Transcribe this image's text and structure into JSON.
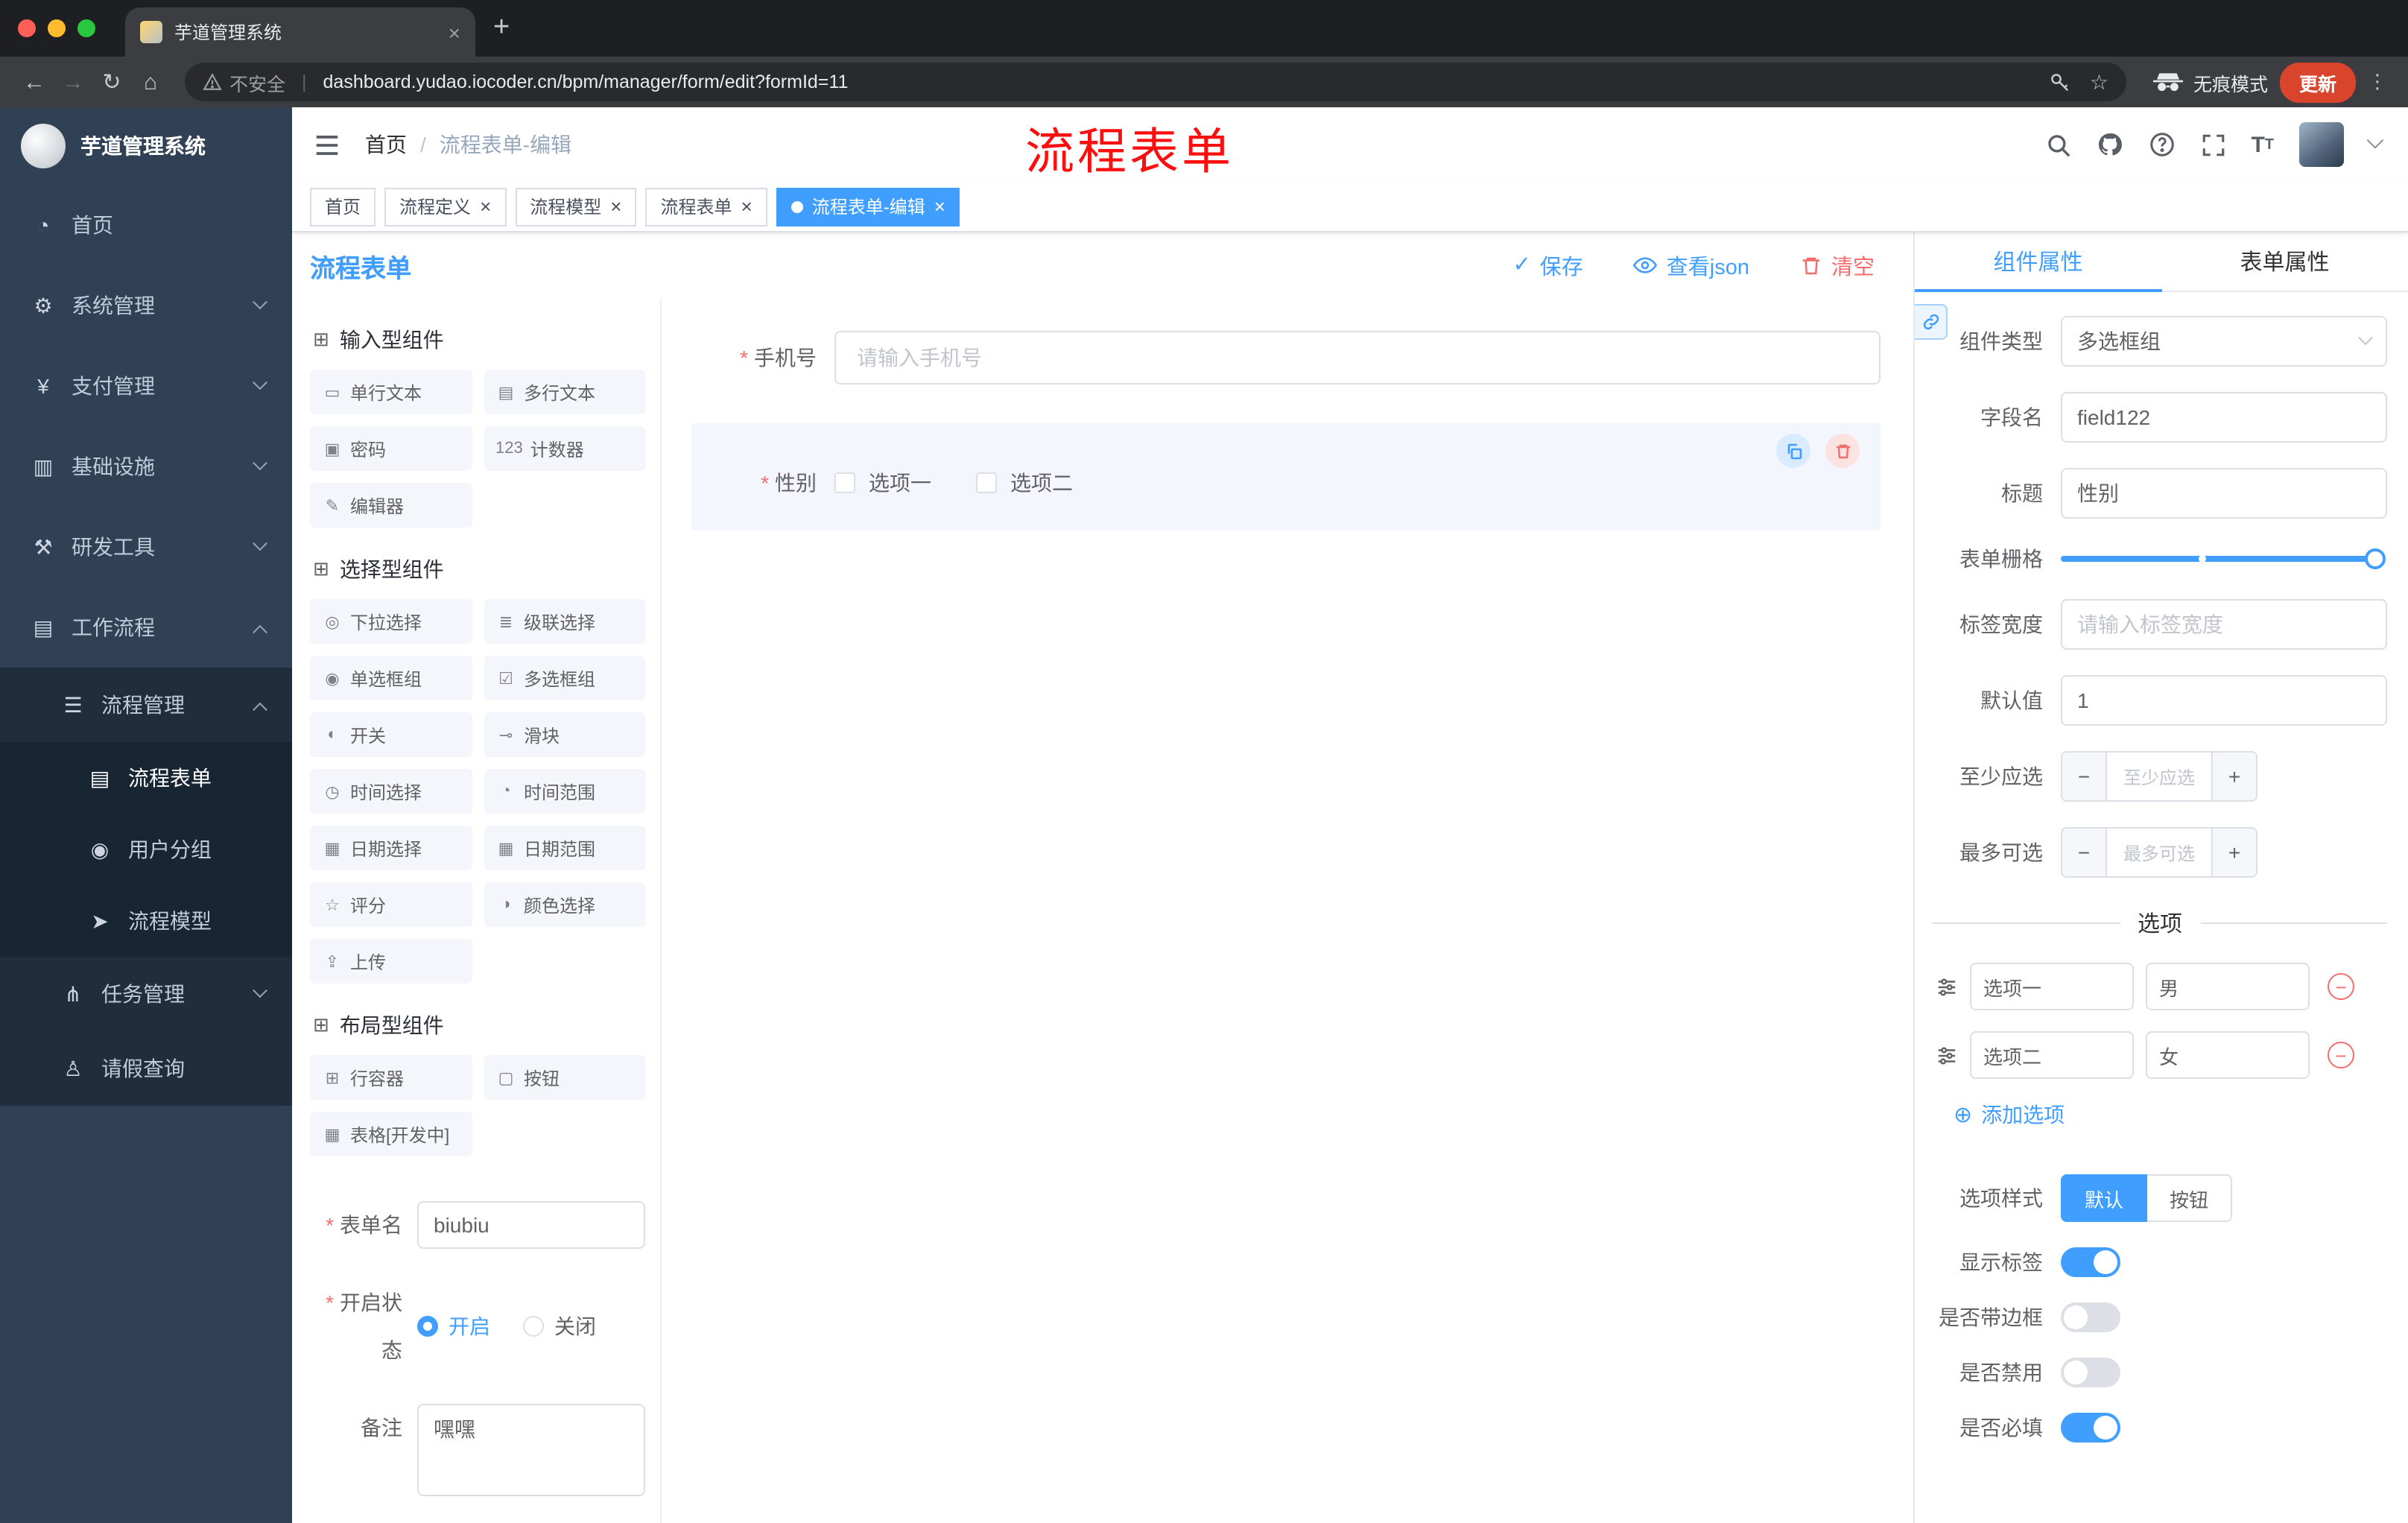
{
  "browser": {
    "tab_title": "芋道管理系统",
    "security_label": "不安全",
    "url": "dashboard.yudao.iocoder.cn/bpm/manager/form/edit?formId=11",
    "incognito_label": "无痕模式",
    "update_label": "更新"
  },
  "sidebar": {
    "logo_title": "芋道管理系统",
    "menu": [
      {
        "label": "首页",
        "icon": "dashboard-icon",
        "level": 0
      },
      {
        "label": "系统管理",
        "icon": "gear-icon",
        "level": 0,
        "chevron": "down"
      },
      {
        "label": "支付管理",
        "icon": "payment-icon",
        "level": 0,
        "chevron": "down"
      },
      {
        "label": "基础设施",
        "icon": "infrastructure-icon",
        "level": 0,
        "chevron": "down"
      },
      {
        "label": "研发工具",
        "icon": "tools-icon",
        "level": 0,
        "chevron": "down"
      },
      {
        "label": "工作流程",
        "icon": "workflow-icon",
        "level": 0,
        "chevron": "up"
      },
      {
        "label": "流程管理",
        "icon": "process-manage-icon",
        "level": 1,
        "chevron": "up"
      },
      {
        "label": "流程表单",
        "icon": "form-icon",
        "level": 2,
        "active": true
      },
      {
        "label": "用户分组",
        "icon": "user-group-icon",
        "level": 2
      },
      {
        "label": "流程模型",
        "icon": "process-model-icon",
        "level": 2
      },
      {
        "label": "任务管理",
        "icon": "task-icon",
        "level": 1,
        "chevron": "down"
      },
      {
        "label": "请假查询",
        "icon": "leave-query-icon",
        "level": 1
      }
    ]
  },
  "header": {
    "breadcrumb_home": "首页",
    "breadcrumb_current": "流程表单-编辑",
    "annotation": "流程表单"
  },
  "tags": [
    {
      "label": "首页"
    },
    {
      "label": "流程定义",
      "closable": true
    },
    {
      "label": "流程模型",
      "closable": true
    },
    {
      "label": "流程表单",
      "closable": true
    },
    {
      "label": "流程表单-编辑",
      "closable": true,
      "active": true
    }
  ],
  "designer": {
    "title": "流程表单",
    "save_label": "保存",
    "view_json_label": "查看json",
    "clear_label": "清空",
    "palette_sections": [
      {
        "title": "输入型组件",
        "items": [
          {
            "label": "单行文本",
            "icon": "text-field-icon"
          },
          {
            "label": "多行文本",
            "icon": "textarea-icon"
          },
          {
            "label": "密码",
            "icon": "password-icon"
          },
          {
            "label": "计数器",
            "icon": "counter-icon"
          },
          {
            "label": "编辑器",
            "icon": "editor-icon"
          }
        ]
      },
      {
        "title": "选择型组件",
        "items": [
          {
            "label": "下拉选择",
            "icon": "select-icon"
          },
          {
            "label": "级联选择",
            "icon": "cascader-icon"
          },
          {
            "label": "单选框组",
            "icon": "radio-group-icon"
          },
          {
            "label": "多选框组",
            "icon": "checkbox-group-icon"
          },
          {
            "label": "开关",
            "icon": "switch-icon"
          },
          {
            "label": "滑块",
            "icon": "slider-icon"
          },
          {
            "label": "时间选择",
            "icon": "time-icon"
          },
          {
            "label": "时间范围",
            "icon": "time-range-icon"
          },
          {
            "label": "日期选择",
            "icon": "date-icon"
          },
          {
            "label": "日期范围",
            "icon": "date-range-icon"
          },
          {
            "label": "评分",
            "icon": "rate-icon"
          },
          {
            "label": "颜色选择",
            "icon": "color-icon"
          },
          {
            "label": "上传",
            "icon": "upload-icon"
          }
        ]
      },
      {
        "title": "布局型组件",
        "items": [
          {
            "label": "行容器",
            "icon": "row-container-icon"
          },
          {
            "label": "按钮",
            "icon": "button-icon"
          },
          {
            "label": "表格[开发中]",
            "icon": "table-icon"
          }
        ]
      }
    ],
    "meta": {
      "form_name_label": "表单名",
      "form_name_value": "biubiu",
      "status_label": "开启状态",
      "status_on": "开启",
      "status_off": "关闭",
      "remark_label": "备注",
      "remark_value": "嘿嘿"
    },
    "canvas": {
      "phone_label": "手机号",
      "phone_placeholder": "请输入手机号",
      "gender_label": "性别",
      "gender_options": [
        "选项一",
        "选项二"
      ]
    }
  },
  "panel": {
    "tab_component": "组件属性",
    "tab_form": "表单属性",
    "component_type_label": "组件类型",
    "component_type_value": "多选框组",
    "field_name_label": "字段名",
    "field_name_value": "field122",
    "title_label": "标题",
    "title_value": "性别",
    "grid_label": "表单栅格",
    "label_width_label": "标签宽度",
    "label_width_placeholder": "请输入标签宽度",
    "default_label": "默认值",
    "default_value": "1",
    "min_label": "至少应选",
    "min_placeholder": "至少应选",
    "max_label": "最多可选",
    "max_placeholder": "最多可选",
    "options_title": "选项",
    "options": [
      {
        "label": "选项一",
        "value": "男"
      },
      {
        "label": "选项二",
        "value": "女"
      }
    ],
    "add_option_label": "添加选项",
    "option_style_label": "选项样式",
    "option_style_default": "默认",
    "option_style_button": "按钮",
    "switches": [
      {
        "label": "显示标签",
        "on": true
      },
      {
        "label": "是否带边框",
        "on": false
      },
      {
        "label": "是否禁用",
        "on": false
      },
      {
        "label": "是否必填",
        "on": true
      }
    ]
  },
  "colors": {
    "accent": "#409eff",
    "danger": "#f56c6c",
    "sidebar_bg": "#304156",
    "submenu_bg": "#1f2d3d",
    "tag_active": "#409eff",
    "annotation": "#fb0e0e",
    "update_pill": "#d9442c",
    "selected_block_bg": "#f4f6fd"
  }
}
